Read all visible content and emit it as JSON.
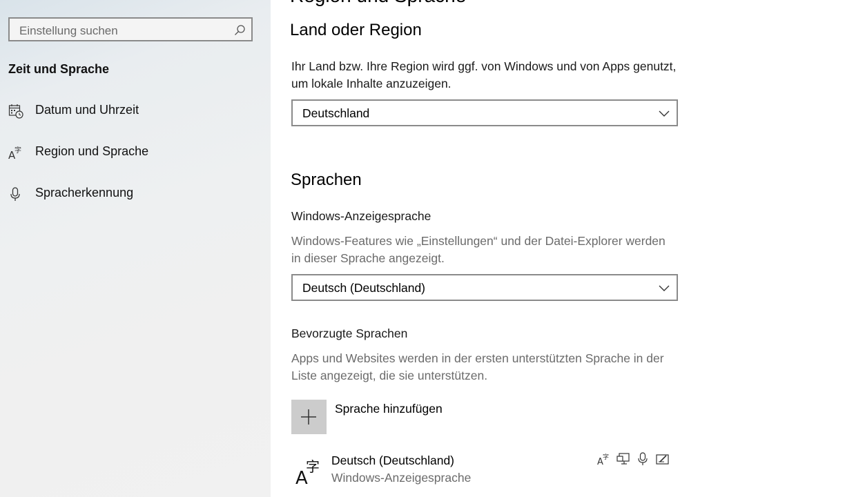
{
  "sidebar": {
    "search": {
      "placeholder": "Einstellung suchen"
    },
    "section_title": "Zeit und Sprache",
    "items": [
      {
        "label": "Datum und Uhrzeit",
        "icon": "calendar-clock-icon"
      },
      {
        "label": "Region und Sprache",
        "icon": "language-icon"
      },
      {
        "label": "Spracherkennung",
        "icon": "microphone-icon"
      }
    ]
  },
  "main": {
    "cut_heading": "Region und Sprache",
    "region": {
      "title": "Land oder Region",
      "description": "Ihr Land bzw. Ihre Region wird ggf. von Windows und von Apps genutzt, um lokale Inhalte anzuzeigen.",
      "selected": "Deutschland"
    },
    "languages": {
      "title": "Sprachen",
      "display_language": {
        "label": "Windows-Anzeigesprache",
        "description": "Windows-Features wie „Einstellungen“ und der Datei-Explorer werden in dieser Sprache angezeigt.",
        "selected": "Deutsch (Deutschland)"
      },
      "preferred": {
        "label": "Bevorzugte Sprachen",
        "description": "Apps und Websites werden in der ersten unterstützten Sprache in der Liste angezeigt, die sie unterstützen.",
        "add_label": "Sprache hinzufügen",
        "items": [
          {
            "name": "Deutsch (Deutschland)",
            "subtitle": "Windows-Anzeigesprache",
            "features": [
              "language-pack-icon",
              "display-icon",
              "microphone-icon",
              "handwriting-icon"
            ]
          }
        ]
      }
    }
  }
}
